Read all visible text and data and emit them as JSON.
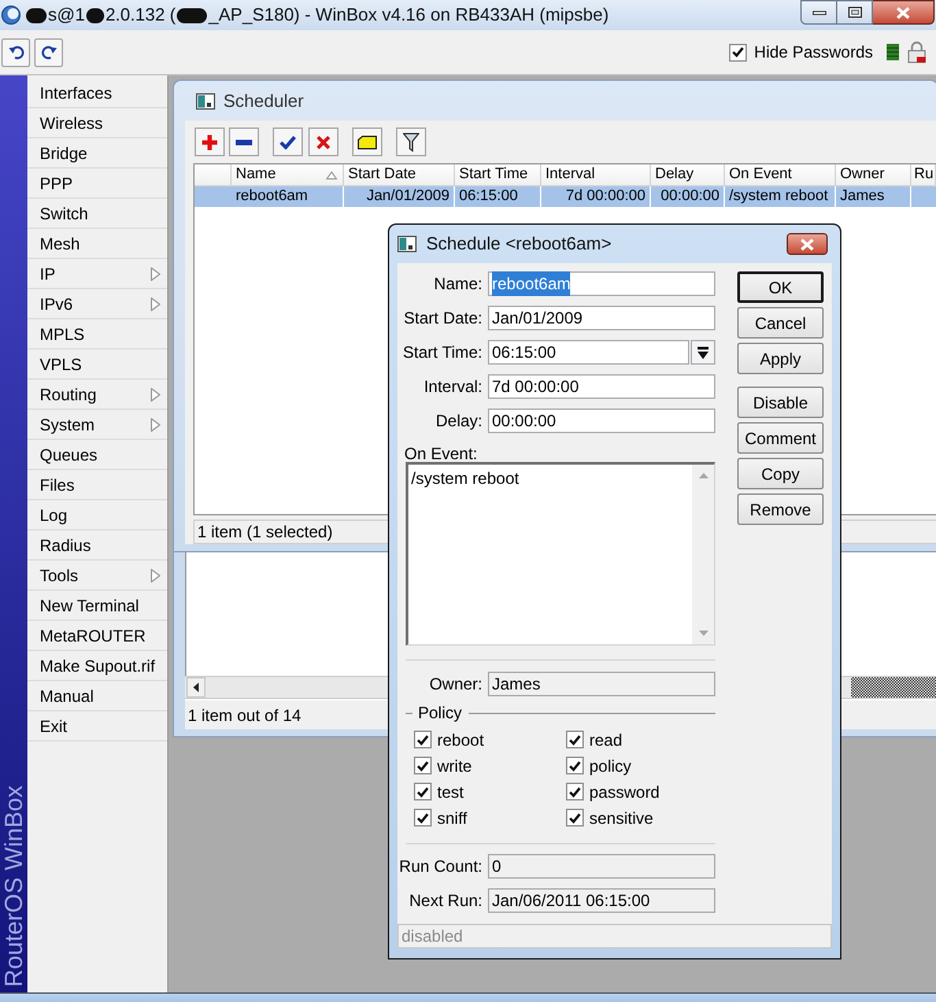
{
  "window": {
    "title_parts": [
      "s@1",
      "2.0.132 (",
      "_AP_S180) - WinBox v4.16 on RB433AH (mipsbe)"
    ]
  },
  "toolbar": {
    "hide_passwords": {
      "label": "Hide Passwords",
      "checked": true
    }
  },
  "sidebar": {
    "brand": "RouterOS WinBox",
    "items": [
      {
        "label": "Interfaces",
        "submenu": false
      },
      {
        "label": "Wireless",
        "submenu": false
      },
      {
        "label": "Bridge",
        "submenu": false
      },
      {
        "label": "PPP",
        "submenu": false
      },
      {
        "label": "Switch",
        "submenu": false
      },
      {
        "label": "Mesh",
        "submenu": false
      },
      {
        "label": "IP",
        "submenu": true
      },
      {
        "label": "IPv6",
        "submenu": true
      },
      {
        "label": "MPLS",
        "submenu": false
      },
      {
        "label": "VPLS",
        "submenu": false
      },
      {
        "label": "Routing",
        "submenu": true
      },
      {
        "label": "System",
        "submenu": true
      },
      {
        "label": "Queues",
        "submenu": false
      },
      {
        "label": "Files",
        "submenu": false
      },
      {
        "label": "Log",
        "submenu": false
      },
      {
        "label": "Radius",
        "submenu": false
      },
      {
        "label": "Tools",
        "submenu": true
      },
      {
        "label": "New Terminal",
        "submenu": false
      },
      {
        "label": "MetaROUTER",
        "submenu": false
      },
      {
        "label": "Make Supout.rif",
        "submenu": false
      },
      {
        "label": "Manual",
        "submenu": false
      },
      {
        "label": "Exit",
        "submenu": false
      }
    ]
  },
  "scheduler": {
    "title": "Scheduler",
    "columns": [
      {
        "label": "Name",
        "sorted": true
      },
      {
        "label": "Start Date",
        "sorted": false
      },
      {
        "label": "Start Time",
        "sorted": false
      },
      {
        "label": "Interval",
        "sorted": false
      },
      {
        "label": "Delay",
        "sorted": false
      },
      {
        "label": "On Event",
        "sorted": false
      },
      {
        "label": "Owner",
        "sorted": false
      },
      {
        "label": "Ru",
        "sorted": false
      }
    ],
    "rows": [
      {
        "selected": true,
        "cells": [
          "reboot6am",
          "Jan/01/2009",
          "06:15:00",
          "7d 00:00:00",
          "00:00:00",
          "/system reboot",
          "James"
        ]
      }
    ],
    "status": "1 item (1 selected)"
  },
  "background_window": {
    "status": "1 item out of 14"
  },
  "dialog": {
    "title": "Schedule <reboot6am>",
    "fields": [
      {
        "label": "Name:",
        "value": "reboot6am",
        "kind": "text",
        "highlighted": true,
        "read_only": false
      },
      {
        "label": "Start Date:",
        "value": "Jan/01/2009",
        "kind": "text",
        "highlighted": false,
        "read_only": false
      },
      {
        "label": "Start Time:",
        "value": "06:15:00",
        "kind": "dropdown",
        "highlighted": false,
        "read_only": false
      },
      {
        "label": "Interval:",
        "value": "7d 00:00:00",
        "kind": "text",
        "highlighted": false,
        "read_only": false
      },
      {
        "label": "Delay:",
        "value": "00:00:00",
        "kind": "text",
        "highlighted": false,
        "read_only": false
      }
    ],
    "on_event": {
      "label": "On Event:",
      "value": "/system reboot"
    },
    "owner": {
      "label": "Owner:",
      "value": "James",
      "read_only": true
    },
    "policy": {
      "title": "Policy",
      "items": [
        {
          "label": "reboot",
          "checked": true
        },
        {
          "label": "read",
          "checked": true
        },
        {
          "label": "write",
          "checked": true
        },
        {
          "label": "policy",
          "checked": true
        },
        {
          "label": "test",
          "checked": true
        },
        {
          "label": "password",
          "checked": true
        },
        {
          "label": "sniff",
          "checked": true
        },
        {
          "label": "sensitive",
          "checked": true
        }
      ]
    },
    "stats": [
      {
        "label": "Run Count:",
        "value": "0",
        "read_only": true
      },
      {
        "label": "Next Run:",
        "value": "Jan/06/2011 06:15:00",
        "read_only": true
      }
    ],
    "status": "disabled",
    "button_groups": [
      [
        {
          "label": "OK",
          "default": true
        },
        {
          "label": "Cancel",
          "default": false
        },
        {
          "label": "Apply",
          "default": false
        }
      ],
      [
        {
          "label": "Disable",
          "default": false
        },
        {
          "label": "Comment",
          "default": false
        },
        {
          "label": "Copy",
          "default": false
        },
        {
          "label": "Remove",
          "default": false
        }
      ]
    ]
  }
}
